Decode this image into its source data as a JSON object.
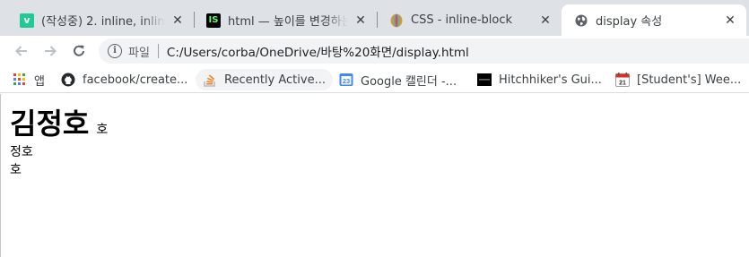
{
  "tabs": [
    {
      "title": "(작성중) 2. inline, inline-block",
      "favicon": "velog-icon",
      "active": false
    },
    {
      "title": "html — 높이를 변경하는 방법",
      "favicon": "intellij-icon",
      "active": false
    },
    {
      "title": "CSS - inline-block",
      "favicon": "css-globe-icon",
      "active": false
    },
    {
      "title": "display 속성",
      "favicon": "globe-icon",
      "active": true
    }
  ],
  "tab_close_glyph": "✕",
  "toolbar": {
    "scheme_label": "파일",
    "url": "C:/Users/corba/OneDrive/바탕%20화면/display.html"
  },
  "bookmarks": [
    {
      "label": "앱",
      "icon": "apps-grid-icon"
    },
    {
      "label": "facebook/create...",
      "icon": "github-icon"
    },
    {
      "label": "Recently Active...",
      "icon": "stackoverflow-icon"
    },
    {
      "label": "Google 캘린더 -...",
      "icon": "google-calendar-icon"
    },
    {
      "label": "Hitchhiker's Gui...",
      "icon": "hitchhiker-icon"
    },
    {
      "label": "[Student's] Wee...",
      "icon": "calendar-icon"
    }
  ],
  "page": {
    "big_text": "김정호",
    "small_inline": "호",
    "line2": "정호",
    "line3": "호"
  },
  "colors": {
    "tabstrip_bg": "#dee1e6",
    "active_tab_bg": "#ffffff",
    "omnibox_bg": "#f1f3f4"
  }
}
